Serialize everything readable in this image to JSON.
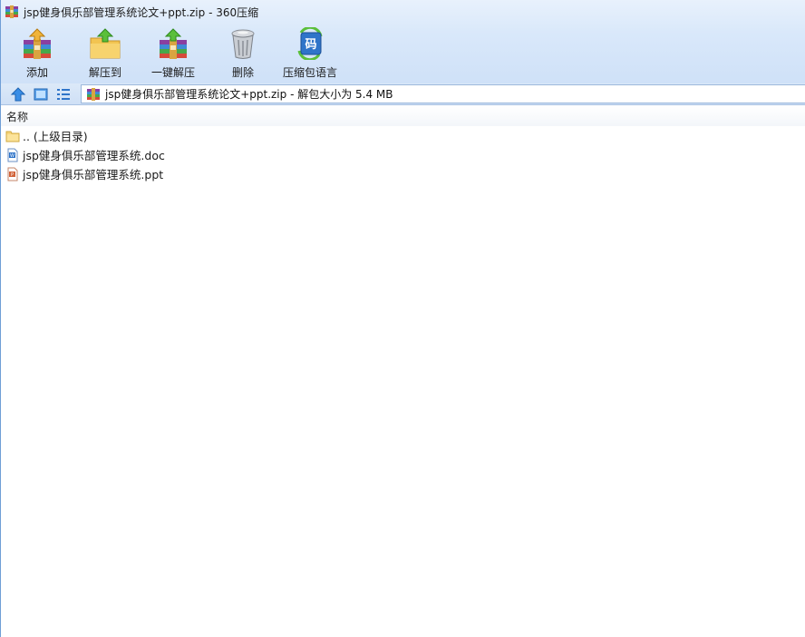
{
  "window": {
    "title": "jsp健身俱乐部管理系统论文+ppt.zip - 360压缩"
  },
  "toolbar": {
    "items": [
      {
        "label": "添加",
        "icon": "archive-add-icon"
      },
      {
        "label": "解压到",
        "icon": "extract-to-folder-icon"
      },
      {
        "label": "一键解压",
        "icon": "one-click-extract-icon"
      },
      {
        "label": "删除",
        "icon": "trash-can-icon"
      },
      {
        "label": "压缩包语言",
        "icon": "archive-language-icon"
      }
    ],
    "language_glyph": "码"
  },
  "address": {
    "path_text": "jsp健身俱乐部管理系统论文+ppt.zip - 解包大小为 5.4 MB"
  },
  "list": {
    "column_name": "名称",
    "rows": [
      {
        "name": ".. (上级目录)",
        "type": "parent-folder"
      },
      {
        "name": "jsp健身俱乐部管理系统.doc",
        "type": "word-document"
      },
      {
        "name": "jsp健身俱乐部管理系统.ppt",
        "type": "powerpoint-document"
      }
    ]
  },
  "colors": {
    "chrome_top": "#e8f1fc",
    "chrome_bottom": "#cfe1f8",
    "border": "#6f9ed6"
  }
}
